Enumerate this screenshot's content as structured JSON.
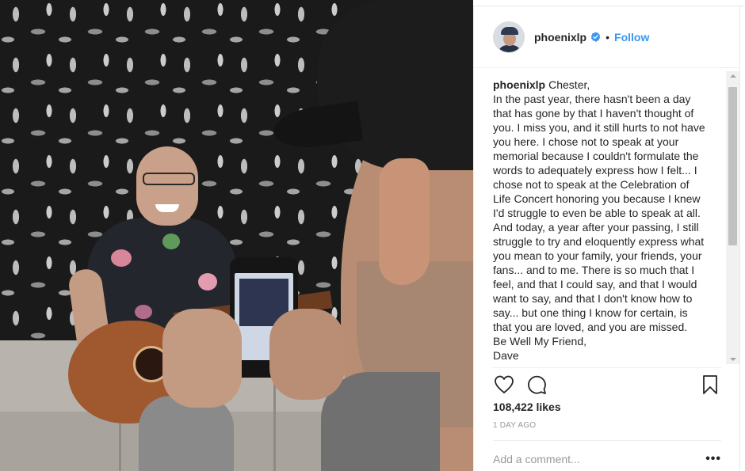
{
  "post": {
    "username": "phoenixlp",
    "dot": "•",
    "follow_label": "Follow",
    "caption_user": "phoenixlp",
    "caption_lines": [
      "Chester,",
      "In the past year, there hasn't been a day",
      "that has gone by that I haven't thought of",
      "you. I miss you, and it still hurts to not have",
      "you here. I chose not to speak at your",
      "memorial because I couldn't formulate the",
      "words to adequately express how I felt... I",
      "chose not to speak at the Celebration of",
      "Life Concert honoring you because I knew",
      "I'd struggle to even be able to speak at all.",
      "And today, a year after your passing, I still",
      "struggle to try and eloquently express what",
      "you mean to your family, your friends, your",
      "fans... and to me. There is so much that I",
      "feel, and that I could say, and that I would",
      "want to say, and that I don't know how to",
      "say... but one thing I know for certain, is",
      "that you are loved, and you are missed.",
      "Be Well My Friend,",
      "Dave"
    ],
    "likes": "108,422 likes",
    "date": "1 DAY AGO",
    "comment_placeholder": "Add a comment...",
    "more_label": "•••"
  },
  "icons": {
    "verified": "verified-badge-icon",
    "like": "heart-icon",
    "comment": "comment-bubble-icon",
    "save": "bookmark-icon",
    "more": "more-options-icon"
  },
  "colors": {
    "link": "#3897f0",
    "text": "#262626",
    "muted": "#999999",
    "divider": "#efefef"
  }
}
